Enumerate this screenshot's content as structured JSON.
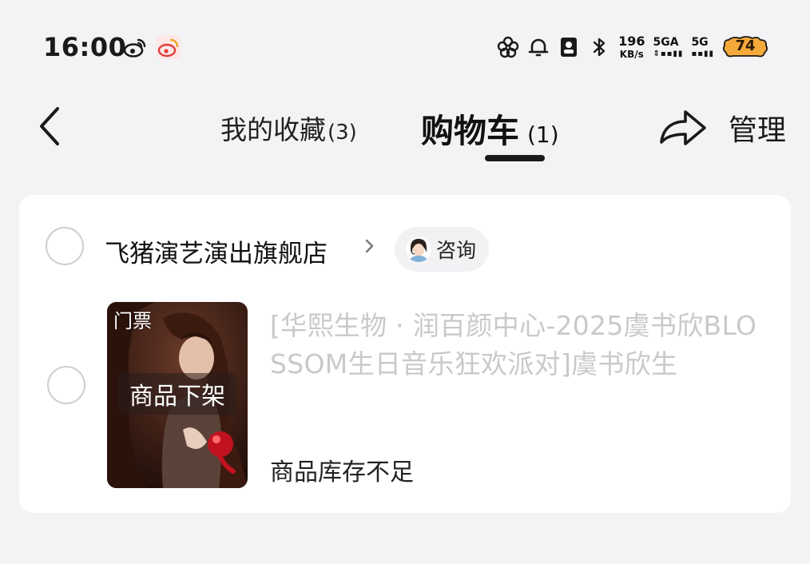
{
  "status_bar": {
    "time": "16:00",
    "app_icons": [
      "weibo-icon",
      "weibo-alt-icon"
    ],
    "system_icons": [
      "flower-icon",
      "bell-icon",
      "id-card-icon",
      "bluetooth-icon"
    ],
    "net_speed_value": "196",
    "net_speed_unit": "KB/s",
    "signal_1_label": "5GA",
    "signal_1_bars": "⇕▪▪▮▮",
    "signal_2_label": "5G",
    "signal_2_bars": "▪▪▮▮",
    "battery_level": "74",
    "battery_color": "#f4a93a"
  },
  "nav": {
    "back_icon": "chevron-left-icon",
    "favorites_tab_label": "我的收藏",
    "favorites_tab_count": "(3)",
    "cart_tab_label": "购物车",
    "cart_tab_count": "(1)",
    "share_icon": "share-arrow-icon",
    "manage_label": "管理"
  },
  "cart": {
    "shop_name": "飞猪演艺演出旗舰店",
    "shop_chevron_icon": "chevron-right-icon",
    "consult_label": "咨询",
    "items": [
      {
        "thumb_tag": "门票",
        "thumb_overlay": "商品下架",
        "title": "[华熙生物 · 润百颜中心-2025虞书欣BLOSSOM生日音乐狂欢派对]虞书欣生",
        "stock_note": "商品库存不足"
      }
    ]
  },
  "colors": {
    "page_bg": "#f3f3f5",
    "card_bg": "#ffffff",
    "title_disabled": "#c9c9cd",
    "radio_border": "#cfcfd3"
  }
}
